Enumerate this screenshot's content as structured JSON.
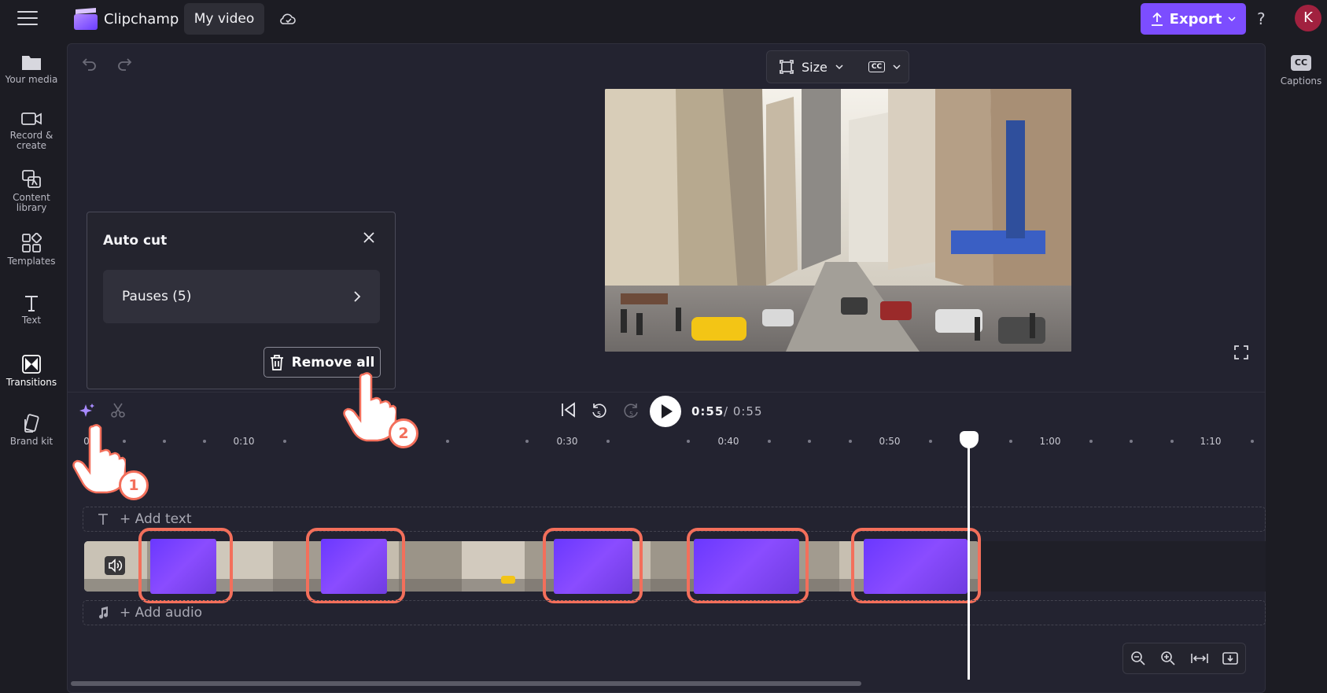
{
  "header": {
    "app_title": "Clipchamp",
    "video_name": "My video",
    "export_label": "Export",
    "help_label": "?",
    "avatar_initial": "K",
    "accent_color": "#7c4dff"
  },
  "sidebar": {
    "items": [
      {
        "label": "Your media",
        "icon": "folder-icon"
      },
      {
        "label": "Record & create",
        "icon": "camera-icon"
      },
      {
        "label": "Content library",
        "icon": "library-icon"
      },
      {
        "label": "Templates",
        "icon": "templates-icon"
      },
      {
        "label": "Text",
        "icon": "text-icon"
      },
      {
        "label": "Transitions",
        "icon": "transitions-icon"
      },
      {
        "label": "Brand kit",
        "icon": "brand-kit-icon"
      }
    ]
  },
  "right_panel": {
    "captions_label": "Captions",
    "cc_text": "CC"
  },
  "preview": {
    "size_label": "Size",
    "cc_text": "CC"
  },
  "autocut": {
    "title": "Auto cut",
    "pauses_label": "Pauses (5)",
    "remove_all_label": "Remove all"
  },
  "playback": {
    "current_time": "0:55",
    "total_time": "/ 0:55"
  },
  "ruler": {
    "labels": [
      "0",
      "0:10",
      "0:30",
      "0:40",
      "0:50",
      "1:00",
      "1:10"
    ]
  },
  "tracks": {
    "add_text_label": "+ Add text",
    "add_audio_label": "+ Add audio"
  },
  "annotations": {
    "step1": "1",
    "step2": "2",
    "highlight_color": "#f36f5b"
  }
}
